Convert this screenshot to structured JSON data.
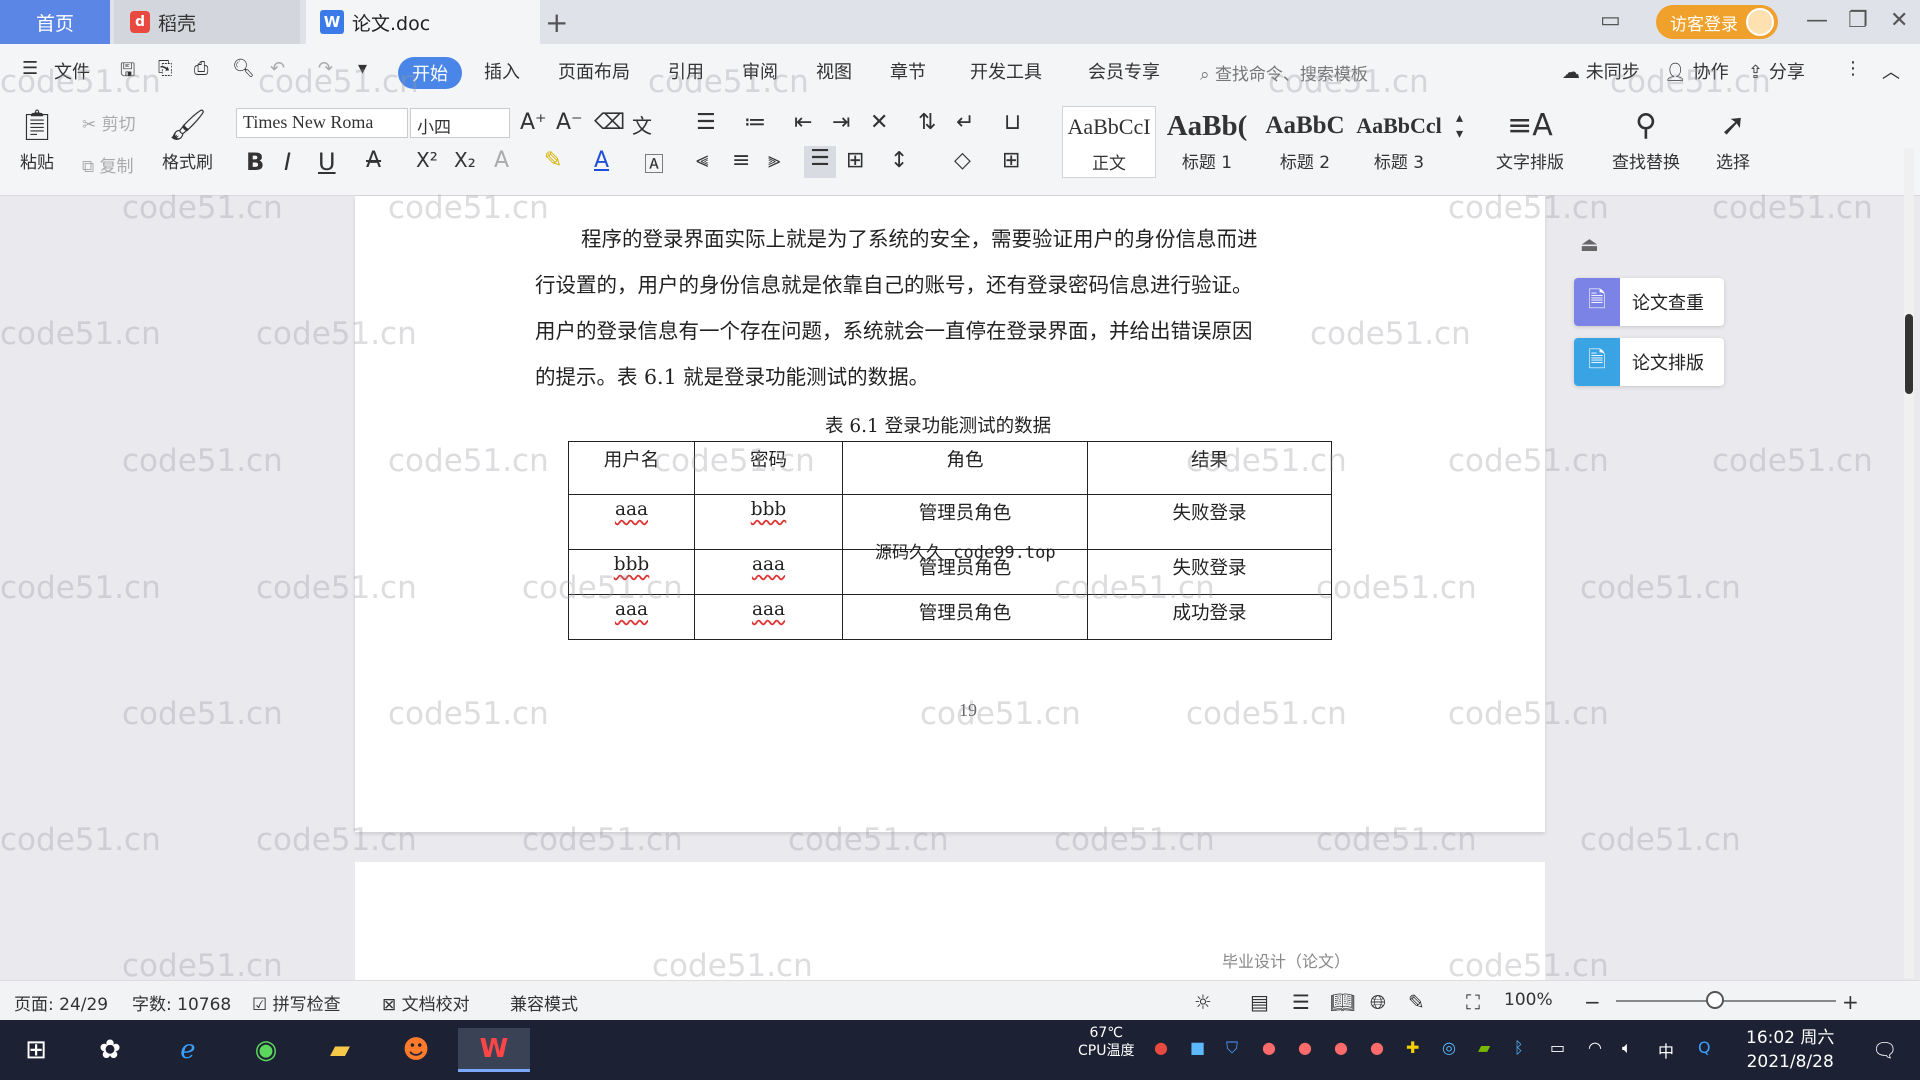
{
  "tabs": {
    "home": "首页",
    "daoke": "稻壳",
    "doc": "论文.doc",
    "login": "访客登录"
  },
  "menu": {
    "file": "文件",
    "start": "开始",
    "insert": "插入",
    "layout": "页面布局",
    "reference": "引用",
    "review": "审阅",
    "view": "视图",
    "chapter": "章节",
    "devtools": "开发工具",
    "member": "会员专享",
    "search_placeholder": "查找命令、搜索模板",
    "sync": "未同步",
    "collab": "协作",
    "share": "分享"
  },
  "ribbon": {
    "paste": "粘贴",
    "cut": "剪切",
    "copy": "复制",
    "format_painter": "格式刷",
    "font_name": "Times New Roma",
    "font_size": "小四",
    "styles": [
      {
        "sample": "AaBbCcI",
        "name": "正文"
      },
      {
        "sample": "AaBb(",
        "name": "标题 1"
      },
      {
        "sample": "AaBbC",
        "name": "标题 2"
      },
      {
        "sample": "AaBbCcl",
        "name": "标题 3"
      }
    ],
    "text_layout": "文字排版",
    "find_replace": "查找替换",
    "select": "选择"
  },
  "document": {
    "paragraph_lines": [
      "程序的登录界面实际上就是为了系统的安全，需要验证用户的身份信息而进",
      "行设置的，用户的身份信息就是依靠自己的账号，还有登录密码信息进行验证。",
      "用户的登录信息有一个存在问题，系统就会一直停在登录界面，并给出错误原因",
      "的提示。表 6.1 就是登录功能测试的数据。"
    ],
    "table_caption": "表 6.1  登录功能测试的数据",
    "table": {
      "headers": [
        "用户名",
        "密码",
        "角色",
        "结果"
      ],
      "rows": [
        [
          "aaa",
          "bbb",
          "管理员角色",
          "失败登录"
        ],
        [
          "bbb",
          "aaa",
          "管理员角色",
          "失败登录"
        ],
        [
          "aaa",
          "aaa",
          "管理员角色",
          "成功登录"
        ]
      ]
    },
    "stamp_text": "源码久久 code99.top",
    "page_number": "19",
    "next_page_header": "毕业设计（论文）",
    "watermark": "code51.cn"
  },
  "side_panel": {
    "check": "论文查重",
    "format": "论文排版"
  },
  "status": {
    "page": "页面: 24/29",
    "words": "字数: 10768",
    "spell": "拼写检查",
    "proof": "文档校对",
    "compat": "兼容模式",
    "zoom": "100%"
  },
  "taskbar": {
    "cpu_temp": "67℃",
    "cpu_label": "CPU温度",
    "ime": "中",
    "time": "16:02 周六",
    "date": "2021/8/28"
  },
  "colors": {
    "accent": "#4a86e8",
    "login_orange": "#f0a12b",
    "taskbar": "#1c2233"
  }
}
